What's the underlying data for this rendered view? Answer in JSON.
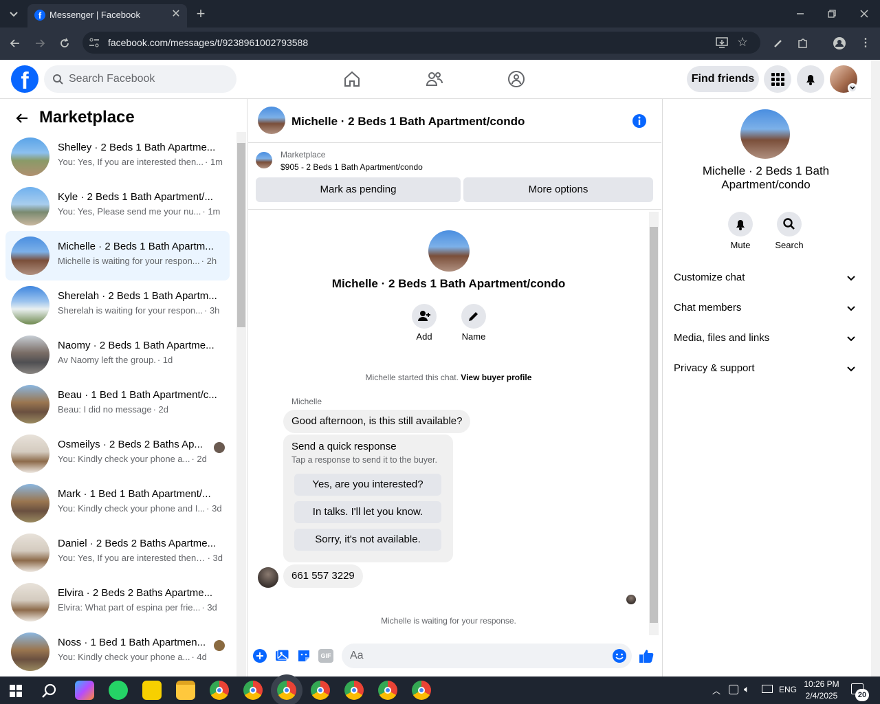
{
  "browser": {
    "tab_title": "Messenger | Facebook",
    "url": "facebook.com/messages/t/9238961002793588"
  },
  "fb": {
    "search_placeholder": "Search Facebook",
    "find_friends": "Find friends"
  },
  "left": {
    "title": "Marketplace",
    "conversations": [
      {
        "name": "Shelley · 2 Beds 1 Bath Apartme...",
        "preview": "You: Yes, If you are interested then...",
        "time": "· 1m"
      },
      {
        "name": "Kyle · 2 Beds 1 Bath Apartment/...",
        "preview": "You: Yes, Please send me your nu...",
        "time": "· 1m"
      },
      {
        "name": "Michelle · 2 Beds 1 Bath Apartm...",
        "preview": "Michelle is waiting for your respon...",
        "time": "· 2h"
      },
      {
        "name": "Sherelah · 2 Beds 1 Bath Apartm...",
        "preview": "Sherelah is waiting for your respon...",
        "time": "· 3h"
      },
      {
        "name": "Naomy · 2 Beds 1 Bath Apartme...",
        "preview": "Av Naomy left the group.",
        "time": "· 1d"
      },
      {
        "name": "Beau · 1 Bed 1 Bath Apartment/c...",
        "preview": "Beau: I did no message",
        "time": "· 2d"
      },
      {
        "name": "Osmeilys · 2 Beds 2 Baths Ap...",
        "preview": "You: Kindly check your phone a...",
        "time": "· 2d"
      },
      {
        "name": "Mark · 1 Bed 1 Bath Apartment/...",
        "preview": "You: Kindly check your phone and I...",
        "time": "· 3d"
      },
      {
        "name": "Daniel · 2 Beds 2 Baths Apartme...",
        "preview": "You: Yes, If you are interested then ...",
        "time": "· 3d"
      },
      {
        "name": "Elvira · 2 Beds 2 Baths Apartme...",
        "preview": "Elvira: What part of espina per frie...",
        "time": "· 3d"
      },
      {
        "name": "Noss · 1 Bed 1 Bath Apartmen...",
        "preview": "You: Kindly check your phone a...",
        "time": "· 4d"
      }
    ]
  },
  "chat": {
    "header_title": "Michelle · 2 Beds 1 Bath Apartment/condo",
    "listing_label": "Marketplace",
    "listing_title": "$905 - 2 Beds 1 Bath Apartment/condo",
    "mark_pending": "Mark as pending",
    "more_options": "More options",
    "profile_name": "Michelle · 2 Beds 1 Bath Apartment/condo",
    "add_label": "Add",
    "name_label": "Name",
    "started_text": "Michelle started this chat.",
    "view_profile": "View buyer profile",
    "sender": "Michelle",
    "message1": "Good afternoon, is this still available?",
    "quick_title": "Send a quick response",
    "quick_sub": "Tap a response to send it to the buyer.",
    "quick_options": [
      "Yes, are you interested?",
      "In talks. I'll let you know.",
      "Sorry, it's not available."
    ],
    "message2": "661 557 3229",
    "waiting": "Michelle is waiting for your response.",
    "composer_placeholder": "Aa"
  },
  "right": {
    "name_line1": "Michelle · 2 Beds 1 Bath",
    "name_line2": "Apartment/condo",
    "mute": "Mute",
    "search": "Search",
    "sections": [
      "Customize chat",
      "Chat members",
      "Media, files and links",
      "Privacy & support"
    ]
  },
  "taskbar": {
    "lang": "ENG",
    "time": "10:26 PM",
    "date": "2/4/2025",
    "notif_count": "20"
  },
  "colors": {
    "fb_blue": "#0866ff",
    "selected_bg": "#ebf5ff",
    "chrome_dark": "#1e2530"
  }
}
